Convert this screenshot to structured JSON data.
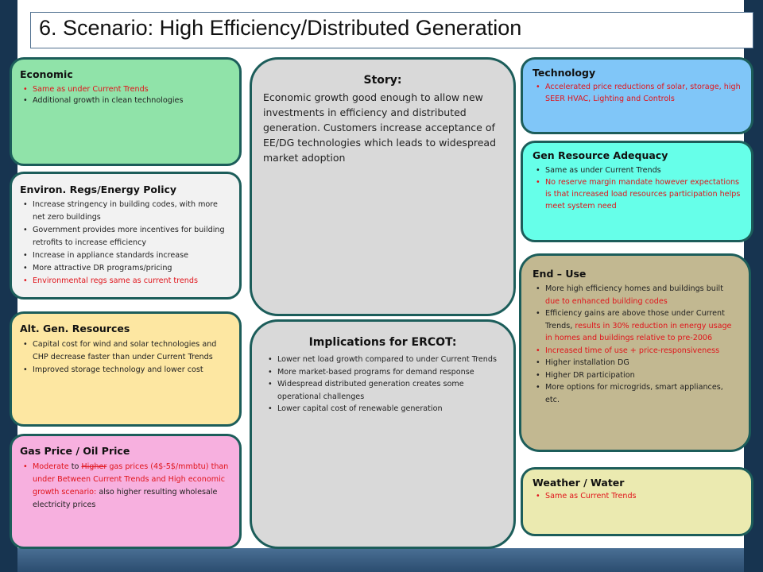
{
  "title": "6. Scenario: High Efficiency/Distributed Generation",
  "colors": {
    "economic": "#90e3a9",
    "environ": "#f2f2f2",
    "altgen": "#fde7a2",
    "gas": "#f7b0df",
    "story": "#d9d9d9",
    "technology": "#80c6f8",
    "resource": "#66ffe9",
    "enduse": "#c2b891",
    "weather": "#ebeab0",
    "red_text": "#e0141b",
    "border": "#1c5d5a"
  },
  "economic": {
    "heading": "Economic",
    "items": [
      "Same as under Current Trends",
      "Additional growth in clean technologies"
    ]
  },
  "environ": {
    "heading": "Environ. Regs/Energy Policy",
    "items": [
      "Increase stringency in building codes, with more net zero buildings",
      "Government provides more incentives for building retrofits to increase efficiency",
      "Increase in appliance standards increase",
      "More attractive DR programs/pricing",
      "Environmental regs same as current trends"
    ]
  },
  "altgen": {
    "heading": "Alt. Gen. Resources",
    "items": [
      "Capital cost for wind and solar technologies and CHP decrease faster than under Current Trends",
      "Improved storage technology and lower cost"
    ]
  },
  "gas": {
    "heading": "Gas Price / Oil Price",
    "line1_a": "Moderate",
    "line1_b": " to ",
    "line1_c": "Higher",
    "line1_d": " gas prices ",
    "line1_e": "(4$-5$/mmbtu)",
    "line2": "than under Between Current Trends and High economic growth scenario:",
    "line2_b": " also higher resulting wholesale electricity prices"
  },
  "story": {
    "heading": "Story:",
    "text": "Economic growth good enough to allow new investments in efficiency and distributed generation.  Customers increase acceptance of EE/DG technologies which leads to widespread market adoption"
  },
  "implications": {
    "heading": "Implications for ERCOT:",
    "items": [
      "Lower net load growth compared to under Current Trends",
      "More market-based programs for demand response",
      "Widespread distributed generation creates some operational challenges",
      "Lower capital cost of renewable generation"
    ]
  },
  "technology": {
    "heading": "Technology",
    "items": [
      "Accelerated price reductions of solar, storage, high SEER HVAC, Lighting and Controls"
    ]
  },
  "resource": {
    "heading": "Gen Resource Adequacy",
    "items": [
      "Same as under Current Trends",
      "No reserve margin mandate however expectations is that increased load resources participation helps meet system need"
    ]
  },
  "enduse": {
    "heading": "End – Use",
    "item1_a": "More high efficiency homes and buildings built ",
    "item1_b": "due to enhanced building codes",
    "item2_a": "Efficiency gains are above those under Current Trends, ",
    "item2_b": "results in 30% reduction in energy usage in homes and buildings relative to pre-2006",
    "item3": "Increased time of use + price-responsiveness",
    "item4": "Higher installation DG",
    "item5": "Higher DR participation",
    "item6": "More options for microgrids, smart appliances, etc."
  },
  "weather": {
    "heading": "Weather / Water",
    "items": [
      "Same as Current Trends"
    ]
  }
}
